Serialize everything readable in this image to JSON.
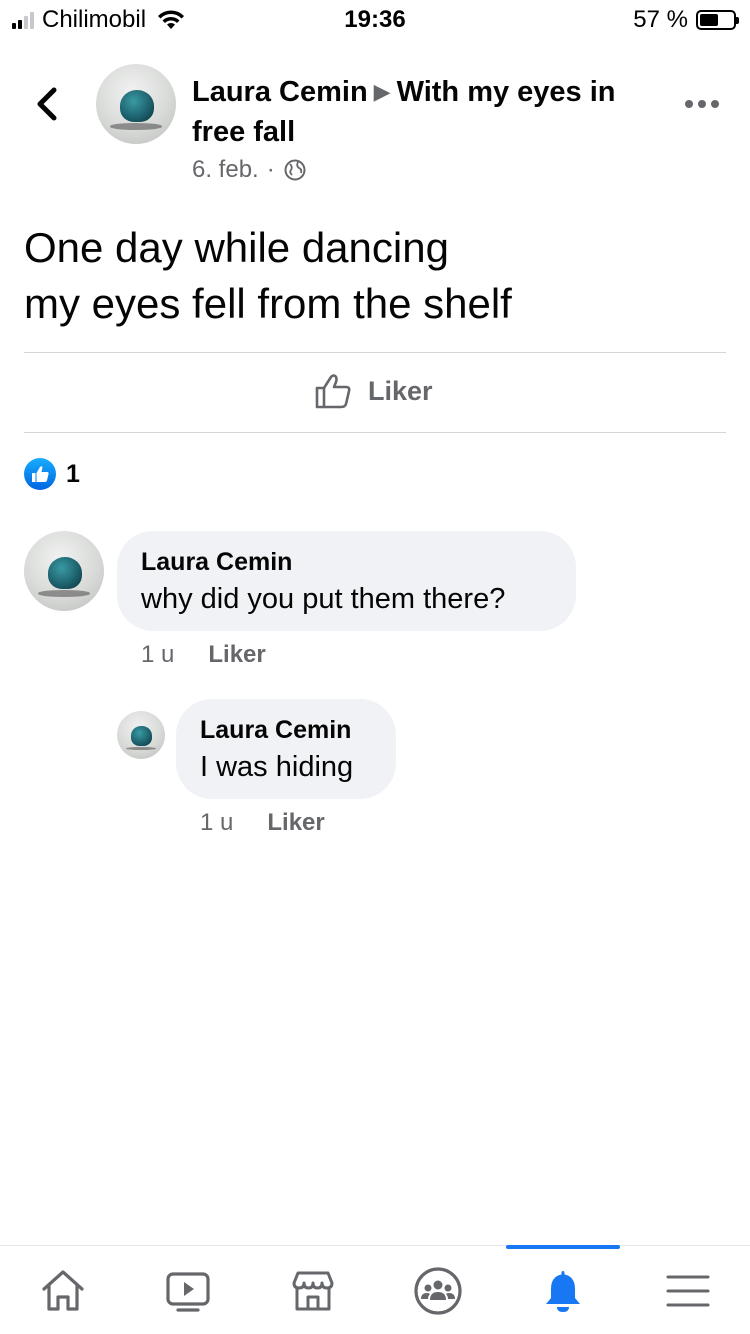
{
  "status_bar": {
    "carrier": "Chilimobil",
    "time": "19:36",
    "battery_percent": "57 %",
    "battery_level": 0.57,
    "signal_bars_active": 2
  },
  "post": {
    "author": "Laura Cemin",
    "group": "With my eyes in free fall",
    "date": "6. feb.",
    "separator": "·",
    "text_lines": [
      "One day while dancing",
      "my eyes fell from the shelf"
    ],
    "like_label": "Liker",
    "reaction_count": "1"
  },
  "comments": [
    {
      "author": "Laura Cemin",
      "text": "why did you put them there?",
      "time": "1 u",
      "like_label": "Liker"
    },
    {
      "author": "Laura Cemin",
      "text": "I was hiding",
      "time": "1 u",
      "like_label": "Liker"
    }
  ],
  "tab_bar": {
    "tabs": [
      "home-icon",
      "video-icon",
      "marketplace-icon",
      "groups-icon",
      "notifications-icon",
      "menu-icon"
    ],
    "active": "notifications-icon",
    "accent_color": "#1877f2",
    "inactive_color": "#65676b"
  }
}
